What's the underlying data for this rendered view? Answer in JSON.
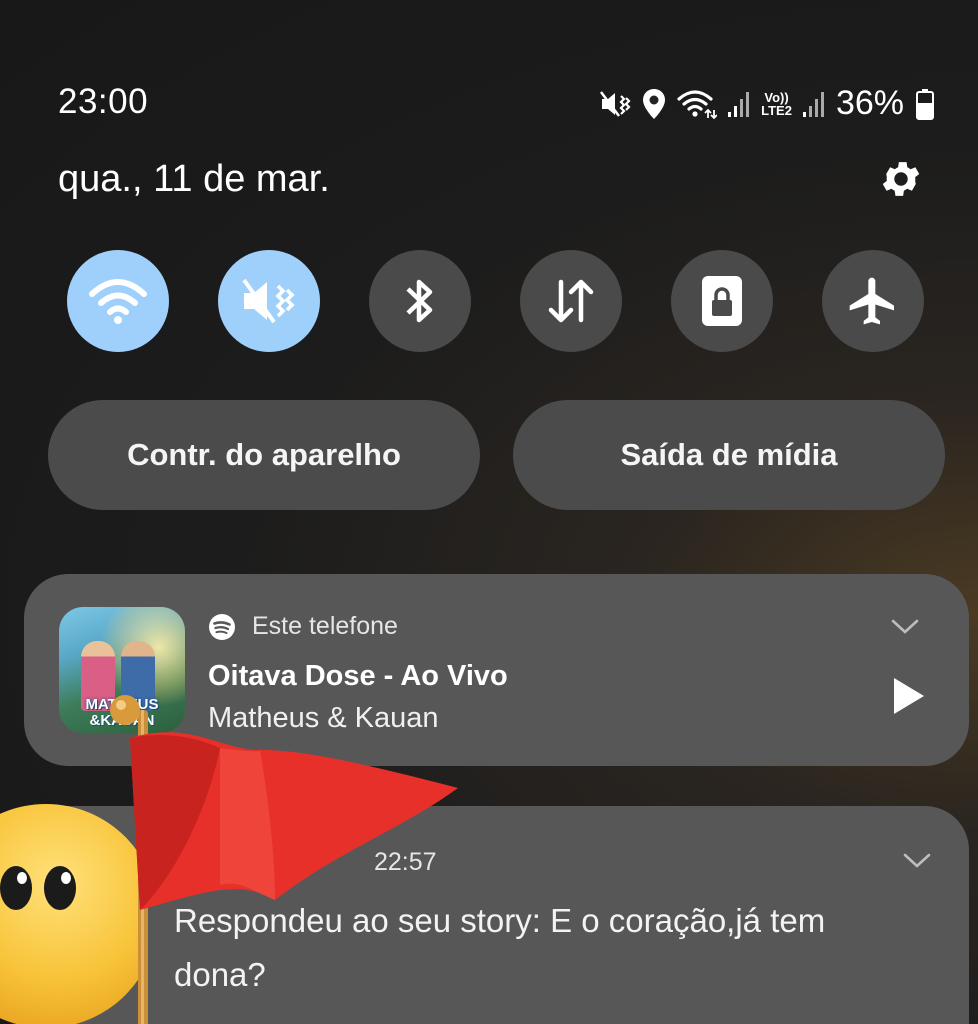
{
  "status_bar": {
    "time": "23:00",
    "icons": [
      "mute-vibrate-icon",
      "location-icon",
      "wifi-icon",
      "signal-icon",
      "volte-icon",
      "signal-icon",
      "battery-icon"
    ],
    "volte_label_top": "Vo))",
    "volte_label_bottom": "LTE2",
    "battery": "36%"
  },
  "header": {
    "date": "qua., 11 de mar.",
    "settings_icon": "gear-icon"
  },
  "quick_settings": [
    {
      "icon": "wifi-icon",
      "state": "on"
    },
    {
      "icon": "mute-icon",
      "state": "on"
    },
    {
      "icon": "bluetooth-icon",
      "state": "off"
    },
    {
      "icon": "data-transfer-icon",
      "state": "off"
    },
    {
      "icon": "rotation-lock-icon",
      "state": "off"
    },
    {
      "icon": "airplane-icon",
      "state": "off"
    }
  ],
  "buttons": {
    "device_control": "Contr. do aparelho",
    "media_output": "Saída de mídia"
  },
  "media": {
    "source": "Este telefone",
    "source_icon": "spotify-icon",
    "title": "Oitava Dose - Ao Vivo",
    "artist": "Matheus & Kauan",
    "art_text_1": "MATHEUS",
    "art_text_2": "&KAUAN"
  },
  "notification": {
    "time": "22:57",
    "text": "Respondeu ao seu story: E o coração,já tem dona?"
  },
  "colors": {
    "tile_on": "#9fd0fb",
    "tile_off": "#4a4a4a",
    "card": "#575757",
    "flag": "#e8302a"
  }
}
